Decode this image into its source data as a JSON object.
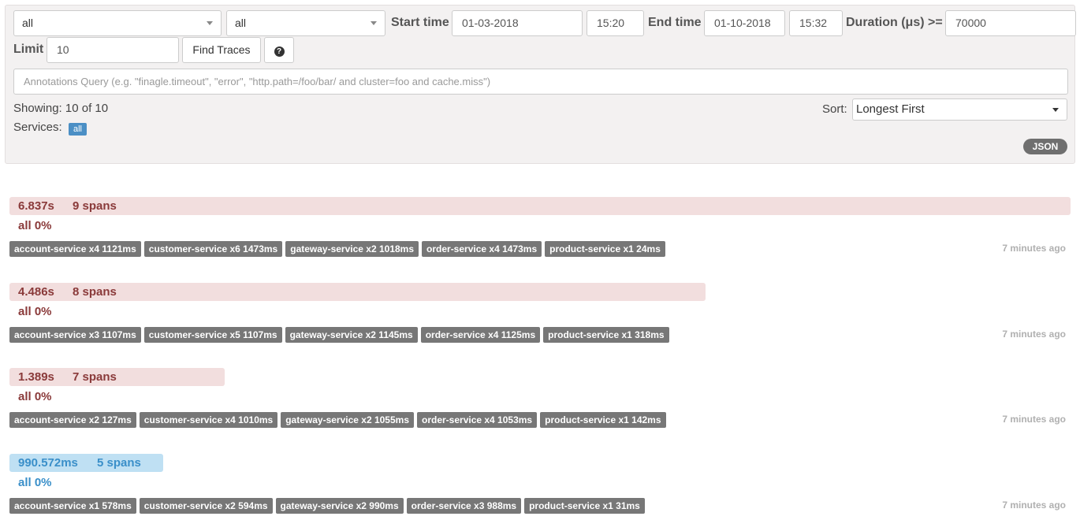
{
  "search": {
    "service_select": "all",
    "span_select": "all",
    "start_time_label": "Start time",
    "start_date": "01-03-2018",
    "start_time": "15:20",
    "end_time_label": "End time",
    "end_date": "01-10-2018",
    "end_time": "15:32",
    "duration_label": "Duration (μs) >=",
    "duration_value": "70000",
    "limit_label": "Limit",
    "limit_value": "10",
    "find_button": "Find Traces",
    "help_icon": "question-circle-icon",
    "help_glyph": "?",
    "annotations_placeholder": "Annotations Query (e.g. \"finagle.timeout\", \"error\", \"http.path=/foo/bar/ and cluster=foo and cache.miss\")"
  },
  "summary": {
    "showing": "Showing: 10 of 10",
    "services_label": "Services:",
    "services_badge": "all",
    "sort_label": "Sort:",
    "sort_value": "Longest First",
    "json_button": "JSON"
  },
  "colors": {
    "panel_bg": "#f3f1f1",
    "bar_red": "#f2dede",
    "bar_blue": "#bfe0f3",
    "tag_gray": "#777777",
    "badge_blue": "#4b8fc5"
  },
  "traces": [
    {
      "duration": "6.837s",
      "spans": "9 spans",
      "all": "all 0%",
      "ago": "7 minutes ago",
      "bar_fraction": 1.0,
      "color": "red",
      "tags": [
        "account-service x4 1121ms",
        "customer-service x6 1473ms",
        "gateway-service x2 1018ms",
        "order-service x4 1473ms",
        "product-service x1 24ms"
      ]
    },
    {
      "duration": "4.486s",
      "spans": "8 spans",
      "all": "all 0%",
      "ago": "7 minutes ago",
      "bar_fraction": 0.656,
      "color": "red",
      "tags": [
        "account-service x3 1107ms",
        "customer-service x5 1107ms",
        "gateway-service x2 1145ms",
        "order-service x4 1125ms",
        "product-service x1 318ms"
      ]
    },
    {
      "duration": "1.389s",
      "spans": "7 spans",
      "all": "all 0%",
      "ago": "7 minutes ago",
      "bar_fraction": 0.203,
      "color": "red",
      "tags": [
        "account-service x2 127ms",
        "customer-service x4 1010ms",
        "gateway-service x2 1055ms",
        "order-service x4 1053ms",
        "product-service x1 142ms"
      ]
    },
    {
      "duration": "990.572ms",
      "spans": "5 spans",
      "all": "all 0%",
      "ago": "7 minutes ago",
      "bar_fraction": 0.145,
      "color": "blue",
      "tags": [
        "account-service x1 578ms",
        "customer-service x2 594ms",
        "gateway-service x2 990ms",
        "order-service x3 988ms",
        "product-service x1 31ms"
      ]
    }
  ]
}
